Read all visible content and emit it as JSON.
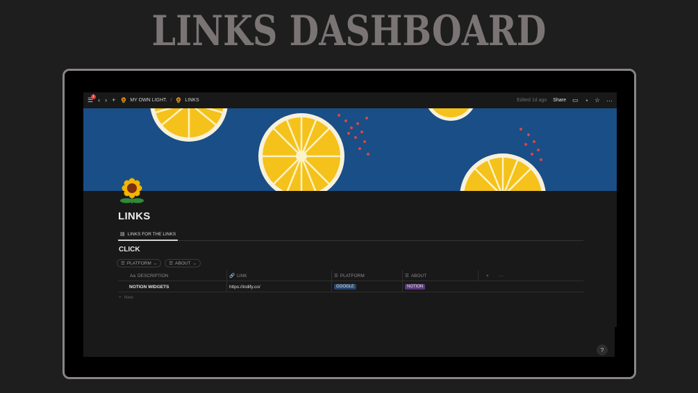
{
  "banner": {
    "title": "LINKS DASHBOARD"
  },
  "topbar": {
    "notification_count": "1",
    "breadcrumb": [
      {
        "icon": "sunflower-icon",
        "label": "MY OWN LIGHT."
      },
      {
        "icon": "sunflower-icon",
        "label": "LINKS"
      }
    ],
    "separator": "/",
    "edited": "Edited 1d ago",
    "share_label": "Share"
  },
  "page": {
    "icon": "sunflower-icon",
    "title": "LINKS",
    "tabs": [
      {
        "label": "LINKS FOR THE LINKS",
        "icon": "table-icon"
      }
    ],
    "view_title": "CLICK",
    "filters": [
      {
        "label": "PLATFORM"
      },
      {
        "label": "ABOUT"
      }
    ],
    "table": {
      "columns": [
        {
          "icon": "Aa",
          "label": "DESCRIPTION"
        },
        {
          "icon": "link-icon",
          "label": "LINK"
        },
        {
          "icon": "list-icon",
          "label": "PLATFORM"
        },
        {
          "icon": "list-icon",
          "label": "ABOUT"
        }
      ],
      "rows": [
        {
          "description": "NOTION WIDGETS",
          "link": "https://indify.co/",
          "platform": "GOOGLE",
          "about": "NOTION"
        }
      ],
      "new_label": "New"
    },
    "help_label": "?"
  },
  "colors": {
    "cover_bg": "#1a4e86",
    "lemon": "#f5c21b",
    "tag_google": "#28456c",
    "tag_notion": "#5a3a7a"
  }
}
